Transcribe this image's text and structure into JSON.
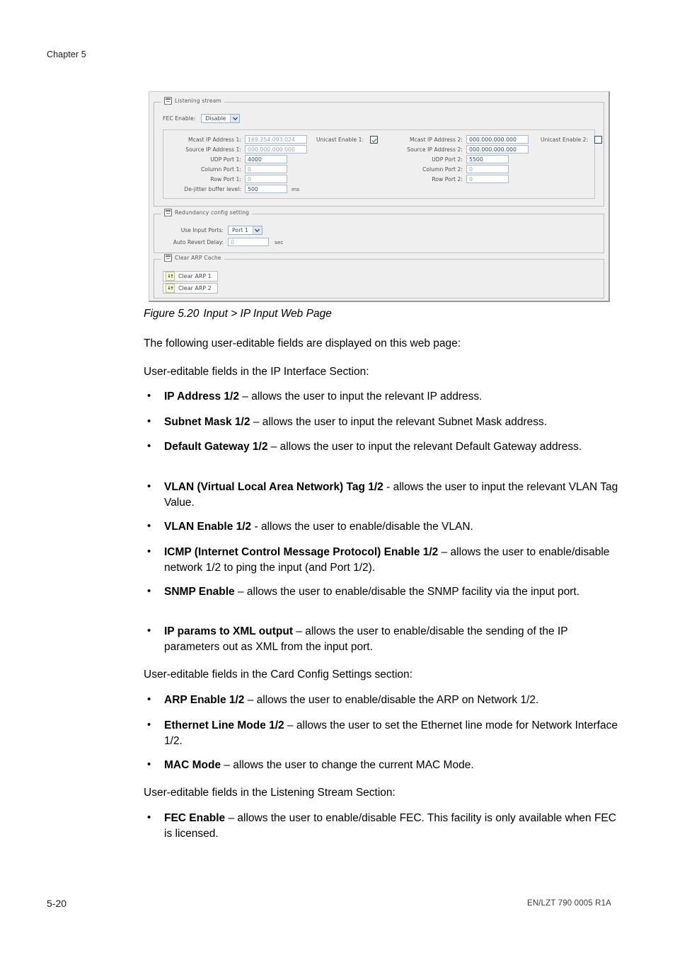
{
  "header": {
    "chapter": "Chapter 5"
  },
  "footer": {
    "page_number": "5-20",
    "doc_id": "EN/LZT 790 0005 R1A"
  },
  "figure": {
    "caption_number": "Figure 5.20",
    "caption_text": "Input > IP Input Web Page",
    "listening_stream": {
      "legend": "Listening stream",
      "fec_enable_label": "FEC Enable:",
      "fec_enable_value": "Disable",
      "columns": [
        {
          "rows": [
            {
              "label": "Mcast IP Address 1:",
              "value": "169.254.093.024",
              "dim": true
            },
            {
              "label": "Source IP Address 1:",
              "value": "000.000.000.000",
              "dim": true
            },
            {
              "label": "UDP Port 1:",
              "value": "4000",
              "dim": false
            },
            {
              "label": "Column Port 1:",
              "value": "0",
              "dim": true
            },
            {
              "label": "Row Port 1:",
              "value": "0",
              "dim": true
            },
            {
              "label": "De-jitter buffer level:",
              "value": "500",
              "dim": false,
              "unit": "ms"
            }
          ],
          "unicast_label": "Unicast Enable 1:",
          "unicast_checked": true
        },
        {
          "rows": [
            {
              "label": "Mcast IP Address 2:",
              "value": "000.000.000.000",
              "dim": false
            },
            {
              "label": "Source IP Address 2:",
              "value": "000.000.000.000",
              "dim": false
            },
            {
              "label": "UDP Port 2:",
              "value": "5500",
              "dim": false
            },
            {
              "label": "Column Port 2:",
              "value": "0",
              "dim": true
            },
            {
              "label": "Row Port 2:",
              "value": "0",
              "dim": true
            }
          ],
          "unicast_label": "Unicast Enable 2:",
          "unicast_checked": false
        }
      ]
    },
    "redundancy": {
      "legend": "Redundancy config setting",
      "use_input_ports_label": "Use Input Ports:",
      "use_input_ports_value": "Port 1",
      "auto_revert_label": "Auto Revert Delay:",
      "auto_revert_value": "0",
      "auto_revert_unit": "sec"
    },
    "clear_arp": {
      "legend": "Clear ARP Cache",
      "buttons": [
        {
          "label": "Clear ARP 1"
        },
        {
          "label": "Clear ARP 2"
        }
      ]
    }
  },
  "body": {
    "intro": "The following user-editable fields are displayed on this web page:",
    "section1_heading": "User-editable fields in the IP Interface Section:",
    "section1_bullets": [
      {
        "term": "IP Address 1/2",
        "desc": " – allows the user to input the relevant IP address."
      },
      {
        "term": "Subnet Mask 1/2",
        "desc": " – allows the user to input the relevant Subnet Mask address."
      },
      {
        "term": "Default Gateway 1/2",
        "desc": " – allows the user to input the relevant Default Gateway address."
      },
      {
        "term": "VLAN (Virtual Local Area Network) Tag 1/2",
        "desc": " - allows the user to input the relevant VLAN Tag Value."
      },
      {
        "term": "VLAN Enable 1/2",
        "desc": " - allows the user to enable/disable the VLAN."
      },
      {
        "term": "ICMP (Internet Control Message Protocol) Enable 1/2",
        "desc": " – allows the user to enable/disable network 1/2 to ping the input (and Port 1/2)."
      },
      {
        "term": "SNMP Enable",
        "desc": " – allows the user to enable/disable the SNMP facility via the input port."
      },
      {
        "term": "IP params to XML output",
        "desc": " – allows the user to enable/disable the sending of the IP parameters out as XML from the input port."
      }
    ],
    "section2_heading": "User-editable fields in the Card Config Settings section:",
    "section2_bullets": [
      {
        "term": "ARP Enable 1/2",
        "desc": " – allows the user to enable/disable the ARP on Network 1/2."
      },
      {
        "term": "Ethernet Line Mode 1/2",
        "desc": " – allows the user to set the Ethernet line mode for Network Interface 1/2."
      },
      {
        "term": "MAC Mode",
        "desc": " – allows the user to change the current MAC Mode."
      }
    ],
    "section3_heading": "User-editable fields in the Listening Stream Section:",
    "section3_bullets": [
      {
        "term": "FEC Enable",
        "desc": " – allows the user to enable/disable FEC. This facility is only available when FEC is licensed."
      }
    ]
  }
}
